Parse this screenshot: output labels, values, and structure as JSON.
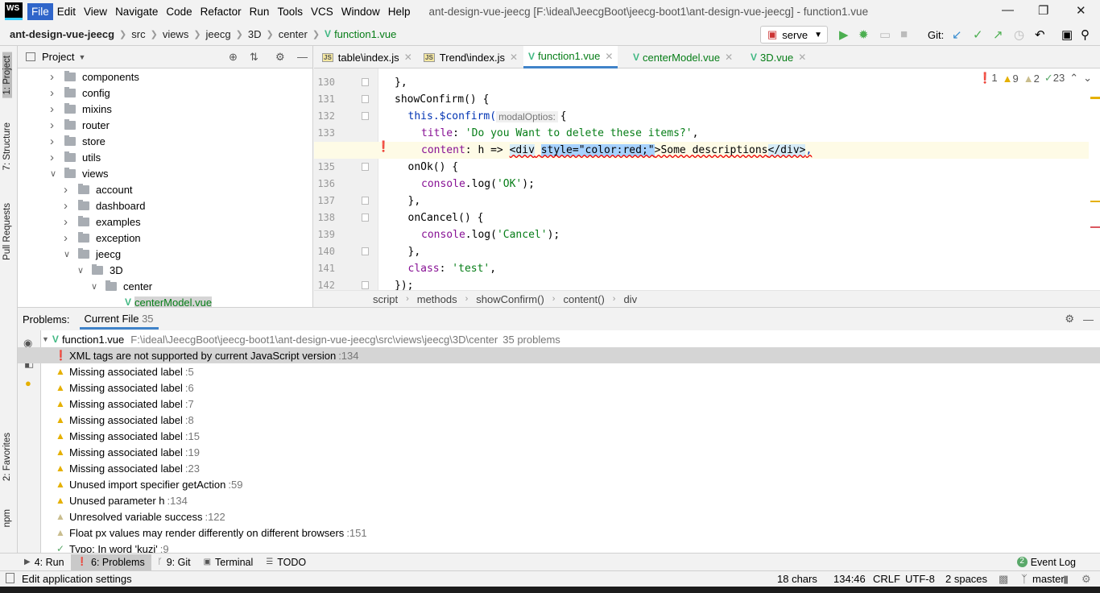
{
  "menubar": {
    "logo": "WS",
    "items": [
      "File",
      "Edit",
      "View",
      "Navigate",
      "Code",
      "Refactor",
      "Run",
      "Tools",
      "VCS",
      "Window",
      "Help"
    ],
    "title": "ant-design-vue-jeecg [F:\\ideal\\JeecgBoot\\jeecg-boot1\\ant-design-vue-jeecg] - function1.vue"
  },
  "navbar": {
    "crumbs": [
      "ant-design-vue-jeecg",
      "src",
      "views",
      "jeecg",
      "3D",
      "center"
    ],
    "file": "function1.vue",
    "run_config": "serve",
    "git_label": "Git:"
  },
  "left_stripe": [
    "1: Project",
    "7: Structure",
    "Pull Requests",
    "2: Favorites",
    "npm"
  ],
  "project": {
    "title": "Project",
    "items": [
      {
        "label": "components",
        "depth": 0,
        "open": false
      },
      {
        "label": "config",
        "depth": 0,
        "open": false
      },
      {
        "label": "mixins",
        "depth": 0,
        "open": false
      },
      {
        "label": "router",
        "depth": 0,
        "open": false
      },
      {
        "label": "store",
        "depth": 0,
        "open": false
      },
      {
        "label": "utils",
        "depth": 0,
        "open": false
      },
      {
        "label": "views",
        "depth": 0,
        "open": true
      },
      {
        "label": "account",
        "depth": 1,
        "open": false
      },
      {
        "label": "dashboard",
        "depth": 1,
        "open": false
      },
      {
        "label": "examples",
        "depth": 1,
        "open": false
      },
      {
        "label": "exception",
        "depth": 1,
        "open": false
      },
      {
        "label": "jeecg",
        "depth": 1,
        "open": true
      },
      {
        "label": "3D",
        "depth": 2,
        "open": true
      },
      {
        "label": "center",
        "depth": 3,
        "open": true
      },
      {
        "label": "centerModel.vue",
        "depth": 4,
        "file": true
      }
    ]
  },
  "tabs": [
    {
      "label": "table\\index.js",
      "type": "js"
    },
    {
      "label": "Trend\\index.js",
      "type": "js"
    },
    {
      "label": "function1.vue",
      "type": "vue",
      "selected": true
    },
    {
      "label": "centerModel.vue",
      "type": "vue"
    },
    {
      "label": "3D.vue",
      "type": "vue"
    }
  ],
  "inspections": {
    "errors": "1",
    "warnings": "9",
    "weak_warnings": "2",
    "typos": "23"
  },
  "code": [
    {
      "n": "130",
      "i": 2,
      "t": [
        [
          "},",
          "d"
        ]
      ]
    },
    {
      "n": "131",
      "i": 2,
      "t": [
        [
          "showConfirm() {",
          "d"
        ]
      ]
    },
    {
      "n": "132",
      "i": 3,
      "t": [
        [
          "this",
          "k"
        ],
        [
          ".$confirm(",
          "k"
        ],
        [
          "modalOptios:",
          "hint"
        ],
        [
          "{",
          "d"
        ]
      ]
    },
    {
      "n": "133",
      "i": 4,
      "t": [
        [
          "title",
          "p"
        ],
        [
          ": ",
          "d"
        ],
        [
          "'Do you Want to delete these items?'",
          "s"
        ],
        [
          ",",
          "d"
        ]
      ]
    },
    {
      "n": "134",
      "i": 4,
      "cur": true,
      "t": [
        [
          "content",
          "p"
        ],
        [
          ": ",
          "d"
        ],
        [
          "h",
          "d"
        ],
        [
          " => ",
          "d"
        ],
        [
          "<div",
          "tag"
        ],
        [
          " ",
          "d"
        ],
        [
          "style=\"color:red;\"",
          "attr"
        ],
        [
          ">Some descriptions",
          "d"
        ],
        [
          "</div>",
          "tag"
        ],
        [
          ",",
          "k"
        ]
      ]
    },
    {
      "n": "135",
      "i": 3,
      "t": [
        [
          "onOk() {",
          "d"
        ]
      ]
    },
    {
      "n": "136",
      "i": 4,
      "t": [
        [
          "console",
          "p"
        ],
        [
          ".log(",
          "d"
        ],
        [
          "'OK'",
          "s"
        ],
        [
          ");",
          "d"
        ]
      ]
    },
    {
      "n": "137",
      "i": 3,
      "t": [
        [
          "},",
          "d"
        ]
      ]
    },
    {
      "n": "138",
      "i": 3,
      "t": [
        [
          "onCancel() {",
          "d"
        ]
      ]
    },
    {
      "n": "139",
      "i": 4,
      "t": [
        [
          "console",
          "p"
        ],
        [
          ".log(",
          "d"
        ],
        [
          "'Cancel'",
          "s"
        ],
        [
          ");",
          "d"
        ]
      ]
    },
    {
      "n": "140",
      "i": 3,
      "t": [
        [
          "},",
          "d"
        ]
      ]
    },
    {
      "n": "141",
      "i": 3,
      "t": [
        [
          "class",
          "p"
        ],
        [
          ": ",
          "d"
        ],
        [
          "'test'",
          "s"
        ],
        [
          ",",
          "d"
        ]
      ]
    },
    {
      "n": "142",
      "i": 2,
      "t": [
        [
          "});",
          "d"
        ]
      ]
    }
  ],
  "editor_breadcrumb": [
    "script",
    "methods",
    "showConfirm()",
    "content()",
    "div"
  ],
  "problems": {
    "label": "Problems:",
    "tab": "Current File",
    "count": "35",
    "file": "function1.vue",
    "path": "F:\\ideal\\JeecgBoot\\jeecg-boot1\\ant-design-vue-jeecg\\src\\views\\jeecg\\3D\\center",
    "summary": "35 problems",
    "items": [
      {
        "type": "error",
        "text": "XML tags are not supported by current JavaScript version",
        "line": ":134"
      },
      {
        "type": "warning",
        "text": "Missing associated label",
        "line": ":5"
      },
      {
        "type": "warning",
        "text": "Missing associated label",
        "line": ":6"
      },
      {
        "type": "warning",
        "text": "Missing associated label",
        "line": ":7"
      },
      {
        "type": "warning",
        "text": "Missing associated label",
        "line": ":8"
      },
      {
        "type": "warning",
        "text": "Missing associated label",
        "line": ":15"
      },
      {
        "type": "warning",
        "text": "Missing associated label",
        "line": ":19"
      },
      {
        "type": "warning",
        "text": "Missing associated label",
        "line": ":23"
      },
      {
        "type": "warning",
        "text": "Unused import specifier getAction",
        "line": ":59"
      },
      {
        "type": "warning",
        "text": "Unused parameter h",
        "line": ":134"
      },
      {
        "type": "weak",
        "text": "Unresolved variable success",
        "line": ":122"
      },
      {
        "type": "weak",
        "text": "Float px values may render differently on different browsers",
        "line": ":151"
      },
      {
        "type": "typo",
        "text": "Typo: In word 'kuzi'",
        "line": ":9"
      }
    ]
  },
  "bottom_tools": [
    "4: Run",
    "6: Problems",
    "9: Git",
    "Terminal",
    "TODO"
  ],
  "event_log": {
    "count": "2",
    "label": "Event Log"
  },
  "status": {
    "message": "Edit application settings",
    "chars": "18 chars",
    "position": "134:46",
    "line_sep": "CRLF",
    "encoding": "UTF-8",
    "indent": "2 spaces",
    "branch": "master"
  },
  "colors": {
    "accent": "#2f65ca",
    "error": "#db5860",
    "warning": "#e5b000",
    "vue": "#41b883"
  }
}
